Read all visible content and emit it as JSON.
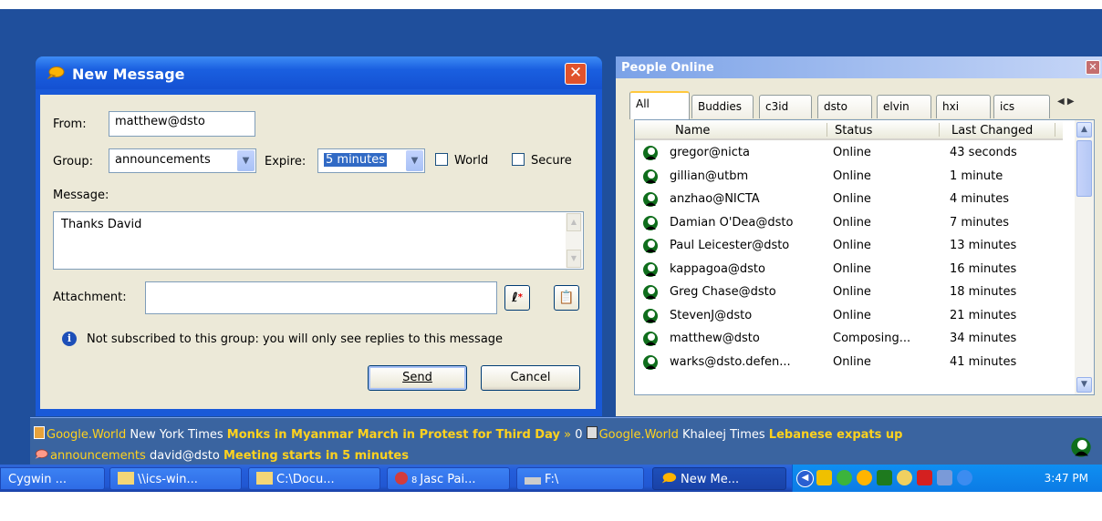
{
  "message_window": {
    "title": "New Message",
    "from_label": "From:",
    "from_value": "matthew@dsto",
    "group_label": "Group:",
    "group_value": "announcements",
    "expire_label": "Expire:",
    "expire_value": "5 minutes",
    "world_label": "World",
    "secure_label": "Secure",
    "message_label": "Message:",
    "message_text": "Thanks David",
    "attachment_label": "Attachment:",
    "attachment_value": "",
    "info_text": "Not subscribed to this group: you will only see replies to this message",
    "send_label": "Send",
    "cancel_label": "Cancel"
  },
  "people_window": {
    "title": "People Online",
    "tabs": [
      "All",
      "Buddies",
      "c3id",
      "dsto",
      "elvin",
      "hxi",
      "ics"
    ],
    "columns": [
      "Name",
      "Status",
      "Last Changed"
    ],
    "rows": [
      {
        "name": "gregor@nicta",
        "status": "Online",
        "changed": "43 seconds"
      },
      {
        "name": "gillian@utbm",
        "status": "Online",
        "changed": "1 minute"
      },
      {
        "name": "anzhao@NICTA",
        "status": "Online",
        "changed": "4 minutes"
      },
      {
        "name": "Damian O'Dea@dsto",
        "status": "Online",
        "changed": "7 minutes"
      },
      {
        "name": "Paul Leicester@dsto",
        "status": "Online",
        "changed": "13 minutes"
      },
      {
        "name": "kappagoa@dsto",
        "status": "Online",
        "changed": "16 minutes"
      },
      {
        "name": "Greg Chase@dsto",
        "status": "Online",
        "changed": "18 minutes"
      },
      {
        "name": "StevenJ@dsto",
        "status": "Online",
        "changed": "21 minutes"
      },
      {
        "name": "matthew@dsto",
        "status": "Composing...",
        "changed": "34 minutes"
      },
      {
        "name": "warks@dsto.defen...",
        "status": "Online",
        "changed": "41 minutes"
      }
    ]
  },
  "ticker": {
    "line1_group": "Google.World",
    "line1_source": "New York Times",
    "line1_headline": "Monks in Myanmar March in Protest for Third Day",
    "line1_sep": "»",
    "line1_count": "0",
    "line2_group": "Google.World",
    "line2_source": "Khaleej Times",
    "line2_headline": "Lebanese expats up",
    "line3_group": "announcements",
    "line3_source": "david@dsto",
    "line3_headline": "Meeting starts in 5 minutes"
  },
  "taskbar": {
    "items": [
      "Cygwin ...",
      "\\\\ics-win...",
      "C:\\Docu...",
      "Jasc Pai...",
      "F:\\",
      "New Me..."
    ],
    "badge": "8",
    "clock": "3:47 PM"
  }
}
